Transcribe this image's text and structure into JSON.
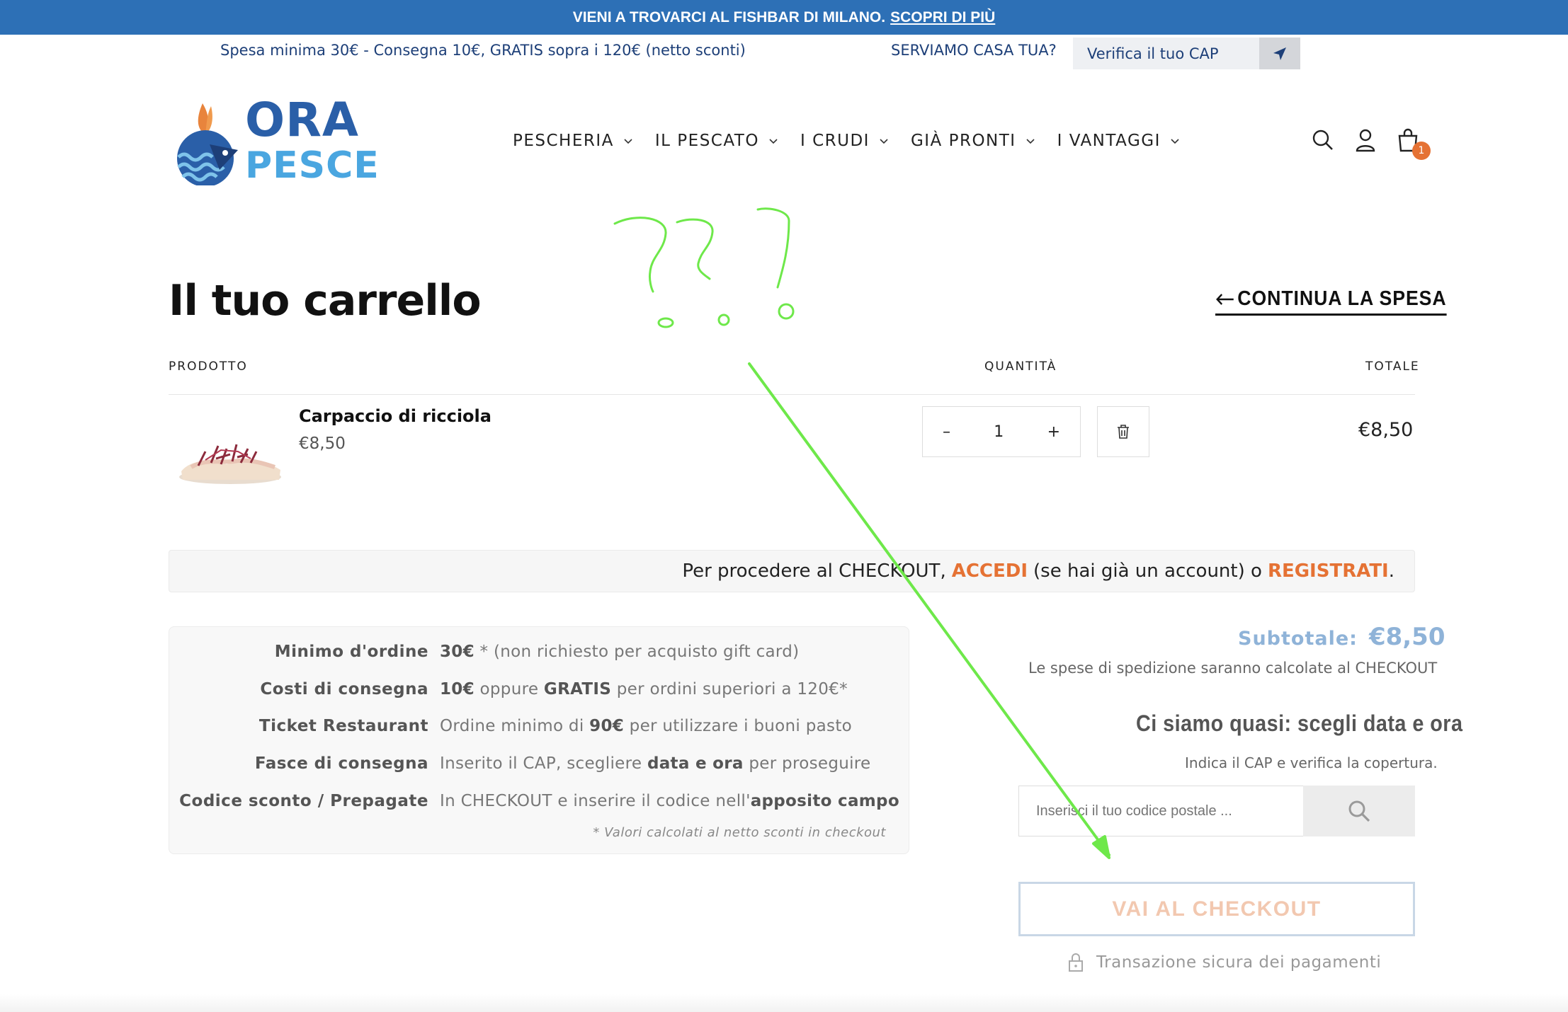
{
  "announcement": {
    "text": "VIENI A TROVARCI AL FISHBAR DI MILANO.",
    "link": "SCOPRI DI PIÙ"
  },
  "infobar": {
    "shipping": "Spesa minima 30€ - Consegna 10€, GRATIS sopra i 120€ (netto sconti)",
    "serve_question": "SERVIAMO CASA TUA?",
    "cap_placeholder": "Verifica il tuo CAP"
  },
  "logo": {
    "line1": "ORA",
    "line2": "PESCE"
  },
  "nav": [
    {
      "label": "PESCHERIA"
    },
    {
      "label": "IL PESCATO"
    },
    {
      "label": "I CRUDI"
    },
    {
      "label": "GIÀ PRONTI"
    },
    {
      "label": "I VANTAGGI"
    }
  ],
  "header_icons": [
    "search-icon",
    "account-icon",
    "cart-icon"
  ],
  "cart_count": "1",
  "page": {
    "title": "Il tuo carrello",
    "continue": "CONTINUA LA SPESA"
  },
  "table": {
    "col_product": "PRODOTTO",
    "col_qty": "QUANTITÀ",
    "col_total": "TOTALE"
  },
  "item": {
    "name": "Carpaccio di ricciola",
    "price": "€8,50",
    "qty": "1",
    "minus": "–",
    "plus": "+",
    "total": "€8,50"
  },
  "notice": {
    "prefix": "Per procedere al CHECKOUT,",
    "login": "ACCEDI",
    "middle": "(se hai già un account) o",
    "register": "REGISTRATI",
    "suffix": "."
  },
  "info": {
    "rows": [
      {
        "label": "Minimo d'ordine",
        "bold": "30€",
        "text": " * (non richiesto per acquisto gift card)"
      },
      {
        "label": "Costi di consegna",
        "bold": "10€",
        "text": " oppure ",
        "bold2": "GRATIS",
        "text2": " per ordini superiori a 120€*"
      },
      {
        "label": "Ticket Restaurant",
        "text": "Ordine minimo di ",
        "bold": "90€",
        "text2": " per utilizzare i buoni pasto"
      },
      {
        "label": "Fasce di consegna",
        "text": "Inserito il CAP, scegliere ",
        "bold": "data e ora",
        "text2": " per proseguire"
      },
      {
        "label": "Codice sconto / Prepagate",
        "text": "In CHECKOUT e inserire il codice nell'",
        "bold": "apposito campo"
      }
    ],
    "note": "* Valori calcolati al netto sconti in checkout"
  },
  "summary": {
    "subtotal_label": "Subtotale:",
    "subtotal_value": "€8,50",
    "shipping_note": "Le spese di spedizione saranno calcolate al CHECKOUT",
    "near_title": "Ci siamo quasi: scegli data e ora",
    "cap_hint": "Indica il CAP e verifica la copertura.",
    "zip_placeholder": "Inserisci il tuo codice postale ...",
    "checkout": "VAI AL CHECKOUT",
    "secure": "Transazione sicura dei pagamenti"
  },
  "colors": {
    "brand_blue": "#2d70b6",
    "accent_orange": "#e57234",
    "annotation_green": "#6ee84a"
  }
}
